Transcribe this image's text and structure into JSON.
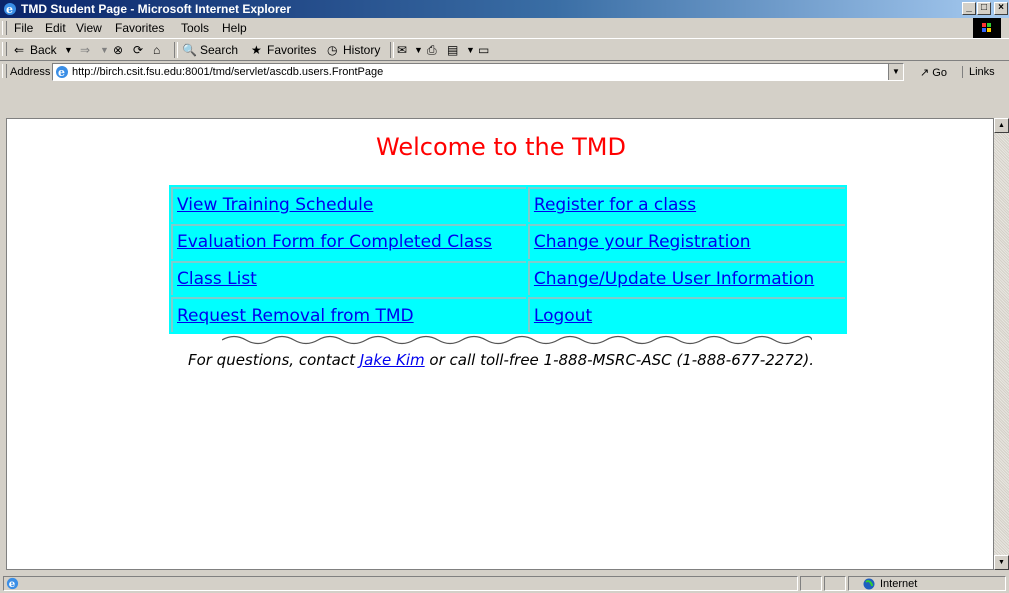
{
  "window": {
    "title": "TMD Student Page - Microsoft Internet Explorer",
    "buttons": [
      "_",
      "□",
      "×"
    ]
  },
  "menu": [
    "File",
    "Edit",
    "View",
    "Favorites",
    "Tools",
    "Help"
  ],
  "toolbar": {
    "back": "Back",
    "search": "Search",
    "favorites": "Favorites",
    "history": "History"
  },
  "address": {
    "label": "Address",
    "url": "http://birch.csit.fsu.edu:8001/tmd/servlet/ascdb.users.FrontPage",
    "go": "Go",
    "links": "Links"
  },
  "page": {
    "heading": "Welcome to the TMD",
    "heading_color": "#ff0000",
    "table_bg": "#00ffff",
    "links": [
      [
        "View Training Schedule",
        "Register for a class"
      ],
      [
        "Evaluation Form for Completed Class",
        "Change your Registration"
      ],
      [
        "Class List",
        "Change/Update User Information"
      ],
      [
        "Request Removal from TMD",
        "Logout"
      ]
    ],
    "contact": {
      "prefix": "For questions, contact ",
      "name": "Jake Kim",
      "suffix": " or call toll-free 1-888-MSRC-ASC (1-888-677-2272)."
    }
  },
  "status": {
    "zone": "Internet"
  }
}
